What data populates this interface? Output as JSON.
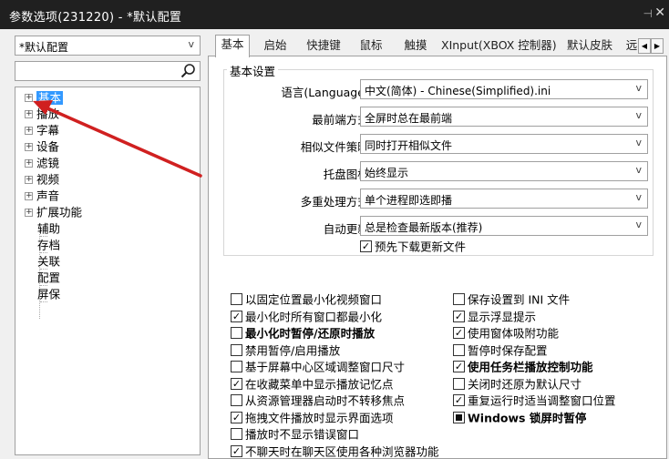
{
  "window": {
    "title": "参数选项(231220) - *默认配置",
    "pin_glyph": "⊣",
    "close_glyph": "✕"
  },
  "profile": {
    "selected": "*默认配置"
  },
  "search": {
    "value": ""
  },
  "tree": {
    "items": [
      {
        "label": "基本",
        "expandable": true
      },
      {
        "label": "播放",
        "expandable": true
      },
      {
        "label": "字幕",
        "expandable": true
      },
      {
        "label": "设备",
        "expandable": true
      },
      {
        "label": "滤镜",
        "expandable": true
      },
      {
        "label": "视频",
        "expandable": true
      },
      {
        "label": "声音",
        "expandable": true
      },
      {
        "label": "扩展功能",
        "expandable": true
      },
      {
        "label": "辅助",
        "expandable": false
      },
      {
        "label": "存档",
        "expandable": false
      },
      {
        "label": "关联",
        "expandable": false
      },
      {
        "label": "配置",
        "expandable": false
      },
      {
        "label": "屏保",
        "expandable": false
      }
    ]
  },
  "tabs": [
    {
      "label": "基本"
    },
    {
      "label": "启始"
    },
    {
      "label": "快捷键"
    },
    {
      "label": "鼠标"
    },
    {
      "label": "触摸"
    },
    {
      "label": "XInput(XBOX 控制器)"
    },
    {
      "label": "默认皮肤"
    },
    {
      "label": "远"
    }
  ],
  "group": {
    "title": "基本设置",
    "fields": [
      {
        "label": "语言(Language):",
        "value": "中文(简体) - Chinese(Simplified).ini"
      },
      {
        "label": "最前端方式:",
        "value": "全屏时总在最前端"
      },
      {
        "label": "相似文件策略:",
        "value": "同时打开相似文件"
      },
      {
        "label": "托盘图标:",
        "value": "始终显示"
      },
      {
        "label": "多重处理方式:",
        "value": "单个进程即选即播"
      },
      {
        "label": "自动更新:",
        "value": "总是检查最新版本(推荐)"
      }
    ],
    "predownload": {
      "label": "预先下载更新文件",
      "checked": true
    }
  },
  "options_left": [
    {
      "label": "以固定位置最小化视频窗口",
      "state": "unchecked"
    },
    {
      "label": "最小化时所有窗口都最小化",
      "state": "checked"
    },
    {
      "label": "最小化时暂停/还原时播放",
      "state": "unchecked",
      "bold": true
    },
    {
      "label": "禁用暂停/启用播放",
      "state": "unchecked"
    },
    {
      "label": "基于屏幕中心区域调整窗口尺寸",
      "state": "unchecked"
    },
    {
      "label": "在收藏菜单中显示播放记忆点",
      "state": "checked"
    },
    {
      "label": "从资源管理器启动时不转移焦点",
      "state": "unchecked"
    },
    {
      "label": "拖拽文件播放时显示界面选项",
      "state": "checked"
    },
    {
      "label": "播放时不显示错误窗口",
      "state": "unchecked"
    },
    {
      "label": "不聊天时在聊天区使用各种浏览器功能",
      "state": "checked"
    }
  ],
  "options_right": [
    {
      "label": "保存设置到 INI 文件",
      "state": "unchecked"
    },
    {
      "label": "显示浮显提示",
      "state": "checked"
    },
    {
      "label": "使用窗体吸附功能",
      "state": "checked"
    },
    {
      "label": "暂停时保存配置",
      "state": "unchecked"
    },
    {
      "label": "使用任务栏播放控制功能",
      "state": "checked",
      "bold": true
    },
    {
      "label": "关闭时还原为默认尺寸",
      "state": "unchecked"
    },
    {
      "label": "重复运行时适当调整窗口位置",
      "state": "checked"
    },
    {
      "label": "Windows 锁屏时暂停",
      "state": "partial",
      "bold": true
    }
  ],
  "colors": {
    "titlebar": "#202020",
    "selection": "#3399ff",
    "annotation_arrow": "#d02020"
  }
}
